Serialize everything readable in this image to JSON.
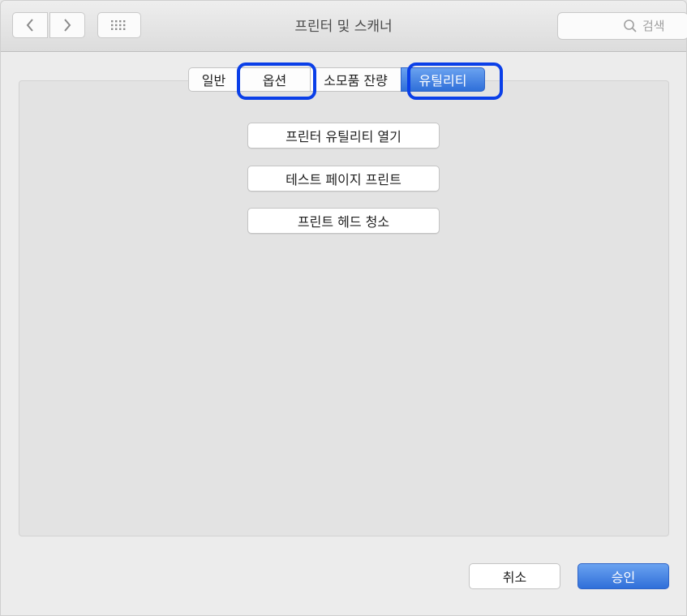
{
  "window": {
    "title": "프린터 및 스캐너"
  },
  "toolbar": {
    "search_placeholder": "검색",
    "back_icon": "chevron-left-icon",
    "forward_icon": "chevron-right-icon",
    "grid_icon": "grid-icon",
    "search_icon": "magnifier-icon"
  },
  "tabs": [
    {
      "label": "일반",
      "active": false
    },
    {
      "label": "옵션",
      "active": false
    },
    {
      "label": "소모품 잔량",
      "active": false
    },
    {
      "label": "유틸리티",
      "active": true
    }
  ],
  "actions": {
    "open_utility": "프린터 유틸리티 열기",
    "test_page": "테스트 페이지 프린트",
    "clean_head": "프린트 헤드 청소"
  },
  "footer": {
    "cancel_label": "취소",
    "ok_label": "승인"
  },
  "colors": {
    "accent": "#2f6fd9",
    "highlight": "#0a3fe8"
  }
}
